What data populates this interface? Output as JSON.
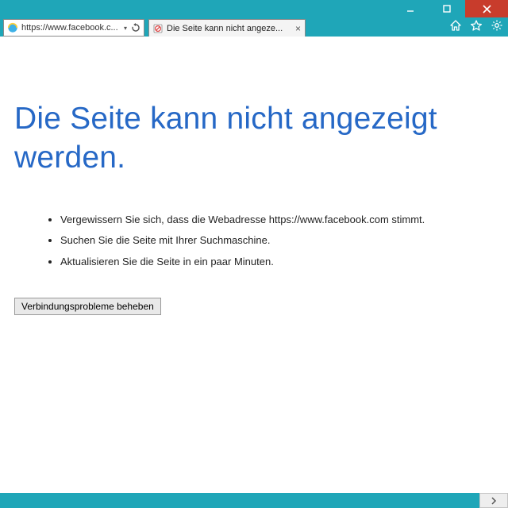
{
  "window": {
    "address_display": "https://www.facebook.c...",
    "tab_title": "Die Seite kann nicht angeze..."
  },
  "error": {
    "heading": "Die Seite kann nicht angezeigt werden.",
    "bullets": [
      "Vergewissern Sie sich, dass die Webadresse https://www.facebook.com stimmt.",
      "Suchen Sie die Seite mit Ihrer Suchmaschine.",
      "Aktualisieren Sie die Seite in ein paar Minuten."
    ],
    "fix_button": "Verbindungsprobleme beheben"
  }
}
